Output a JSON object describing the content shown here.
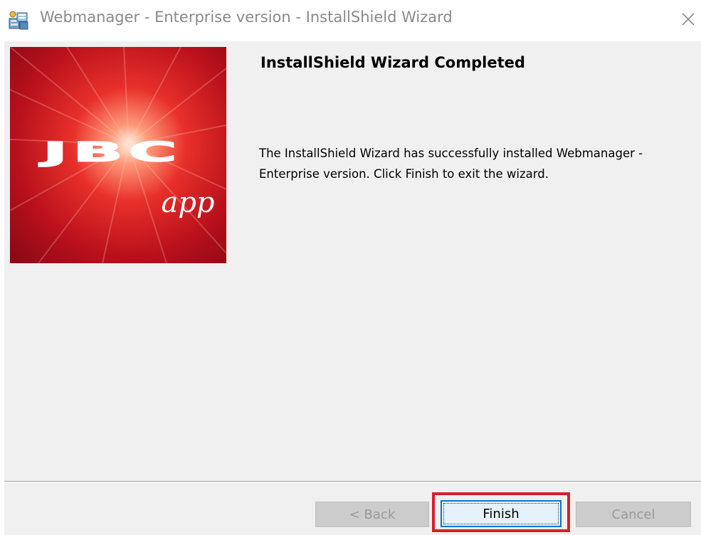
{
  "window": {
    "title": "Webmanager - Enterprise version - InstallShield Wizard",
    "icon": "installer-package-icon",
    "close_icon": "close-icon"
  },
  "banner": {
    "logo_text": "JBC",
    "app_text": "app",
    "background_color": "#c8141e"
  },
  "main": {
    "heading": "InstallShield Wizard Completed",
    "message": "The InstallShield Wizard has successfully installed Webmanager - Enterprise version. Click Finish to exit the wizard."
  },
  "buttons": {
    "back_label": "< Back",
    "back_enabled": false,
    "finish_label": "Finish",
    "finish_highlighted": true,
    "highlight_color": "#d71f2a",
    "cancel_label": "Cancel",
    "cancel_enabled": false
  }
}
